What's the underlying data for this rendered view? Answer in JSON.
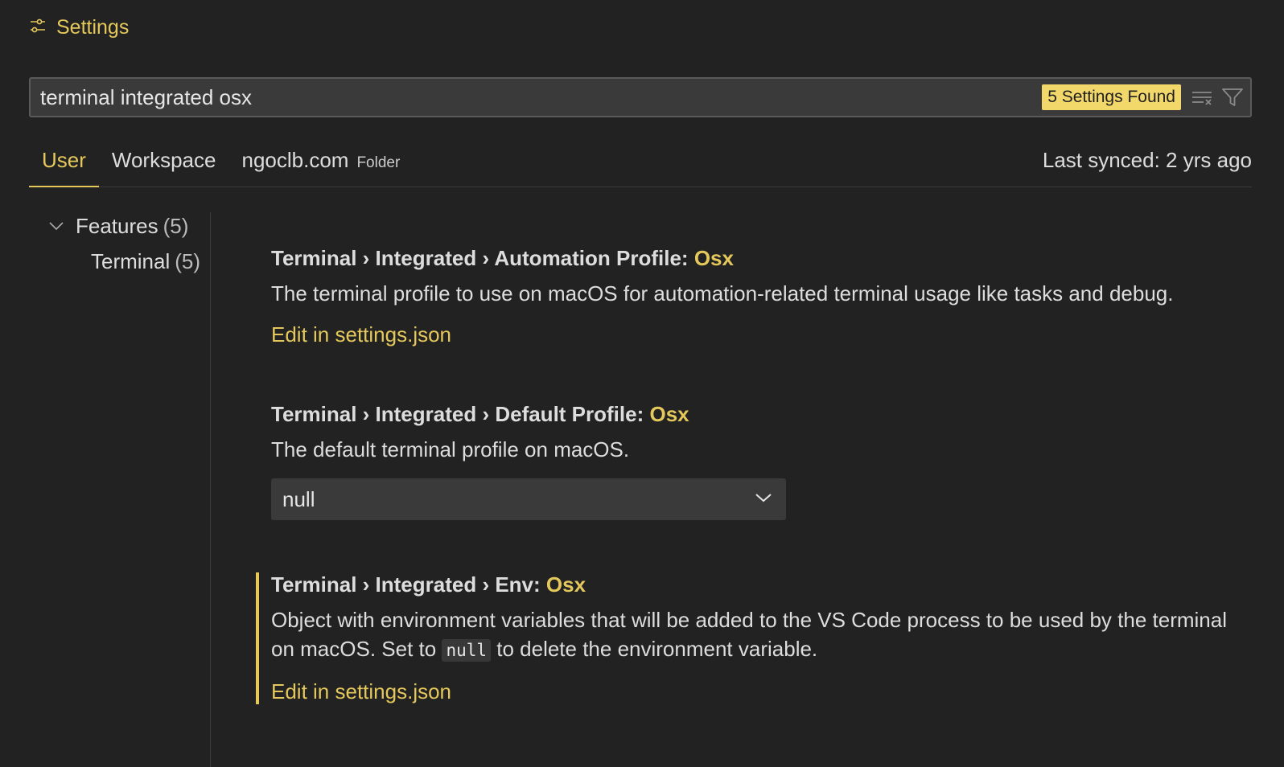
{
  "header": {
    "title": "Settings"
  },
  "search": {
    "value": "terminal integrated osx",
    "found_badge": "5 Settings Found"
  },
  "tabs": [
    {
      "label": "User",
      "active": true
    },
    {
      "label": "Workspace",
      "active": false
    },
    {
      "label": "ngoclb.com",
      "tag": "Folder",
      "active": false
    }
  ],
  "sync": {
    "status": "Last synced: 2 yrs ago"
  },
  "tree": {
    "group": {
      "label": "Features",
      "count": "(5)"
    },
    "child": {
      "label": "Terminal",
      "count": "(5)"
    }
  },
  "settings": [
    {
      "prefix": "Terminal › Integrated › Automation Profile: ",
      "key": "Osx",
      "description": "The terminal profile to use on macOS for automation-related terminal usage like tasks and debug.",
      "edit_link": "Edit in settings.json"
    },
    {
      "prefix": "Terminal › Integrated › Default Profile: ",
      "key": "Osx",
      "description": "The default terminal profile on macOS.",
      "select_value": "null"
    },
    {
      "prefix": "Terminal › Integrated › Env: ",
      "key": "Osx",
      "description_part1": "Object with environment variables that will be added to the VS Code process to be used by the terminal on macOS. Set to ",
      "description_code": "null",
      "description_part2": " to delete the environment variable.",
      "edit_link": "Edit in settings.json"
    }
  ],
  "colors": {
    "accent": "#e5c85c",
    "background": "#222222",
    "badge": "#f2d86b"
  },
  "icons": {
    "title": "settings-sliders-icon",
    "clear": "clear-filter-icon",
    "filter": "filter-icon",
    "chevron_tree": "chevron-down-icon",
    "chevron_select": "chevron-down-icon"
  }
}
